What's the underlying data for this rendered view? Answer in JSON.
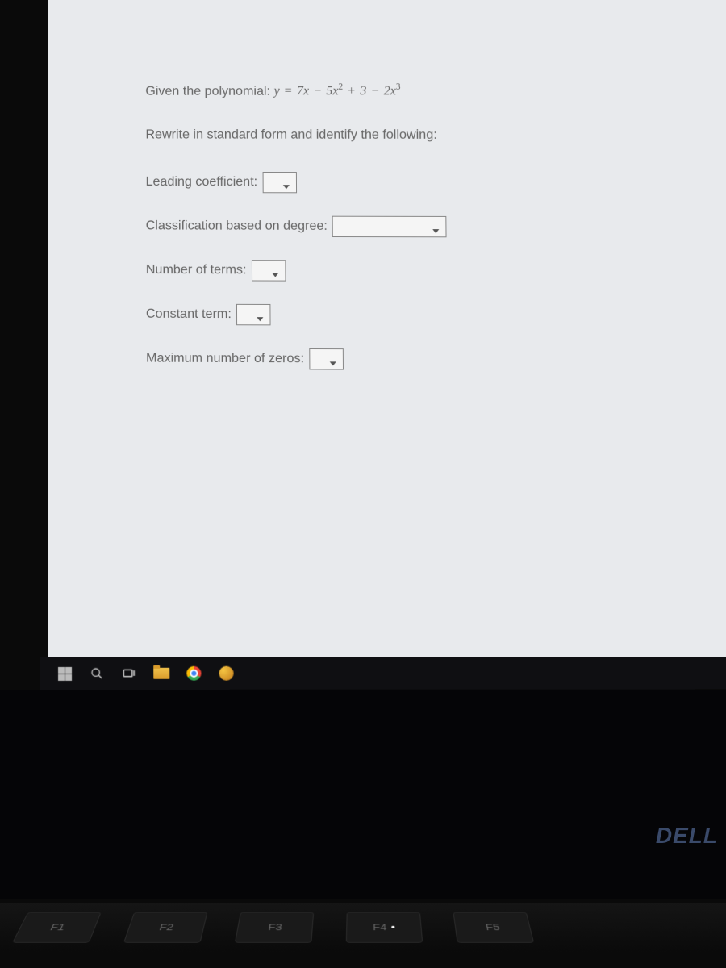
{
  "question": {
    "prefix": "Given the polynomial: ",
    "polynomial_text": "y = 7x − 5x² + 3 − 2x³",
    "instruction": "Rewrite in standard form and identify the following:",
    "fields": [
      {
        "label": "Leading coefficient:",
        "size": "small"
      },
      {
        "label": "Classification based on degree:",
        "size": "large"
      },
      {
        "label": "Number of terms:",
        "size": "small"
      },
      {
        "label": "Constant term:",
        "size": "medium"
      },
      {
        "label": "Maximum number of zeros:",
        "size": "medium"
      }
    ]
  },
  "taskbar": {
    "items": [
      "start",
      "search",
      "task-view",
      "file-explorer",
      "chrome",
      "app"
    ]
  },
  "keyboard": {
    "keys": [
      "F1",
      "F2",
      "F3",
      "F4",
      "F5"
    ]
  },
  "brand": "DELL"
}
